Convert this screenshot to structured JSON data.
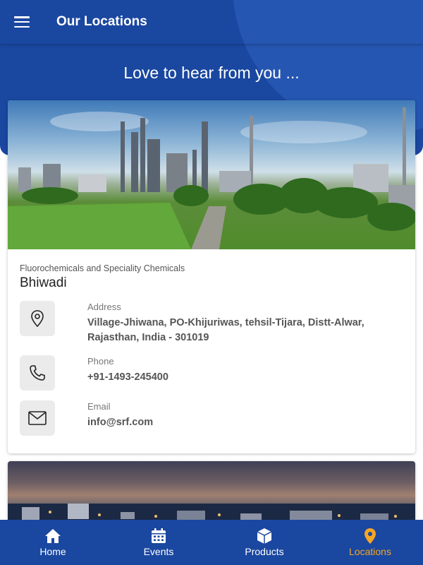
{
  "app_bar": {
    "title": "Our Locations",
    "menu_icon": "hamburger-menu-icon"
  },
  "hero": {
    "tagline": "Love to hear from you ..."
  },
  "locations": [
    {
      "category": "Fluorochemicals and Speciality Chemicals",
      "name": "Bhiwadi",
      "address_label": "Address",
      "address": "Village-Jhiwana, PO-Khijuriwas, tehsil-Tijara, Distt-Alwar, Rajasthan, India - 301019",
      "phone_label": "Phone",
      "phone": "+91-1493-245400",
      "email_label": "Email",
      "email": "info@srf.com"
    }
  ],
  "bottom_nav": [
    {
      "label": "Home",
      "icon": "home-icon",
      "active": false
    },
    {
      "label": "Events",
      "icon": "calendar-icon",
      "active": false
    },
    {
      "label": "Products",
      "icon": "box-icon",
      "active": false
    },
    {
      "label": "Locations",
      "icon": "location-pin-icon",
      "active": true
    }
  ],
  "colors": {
    "primary": "#1a47a0",
    "accent": "#f5a623",
    "hero_circle": "#2f63c0"
  }
}
